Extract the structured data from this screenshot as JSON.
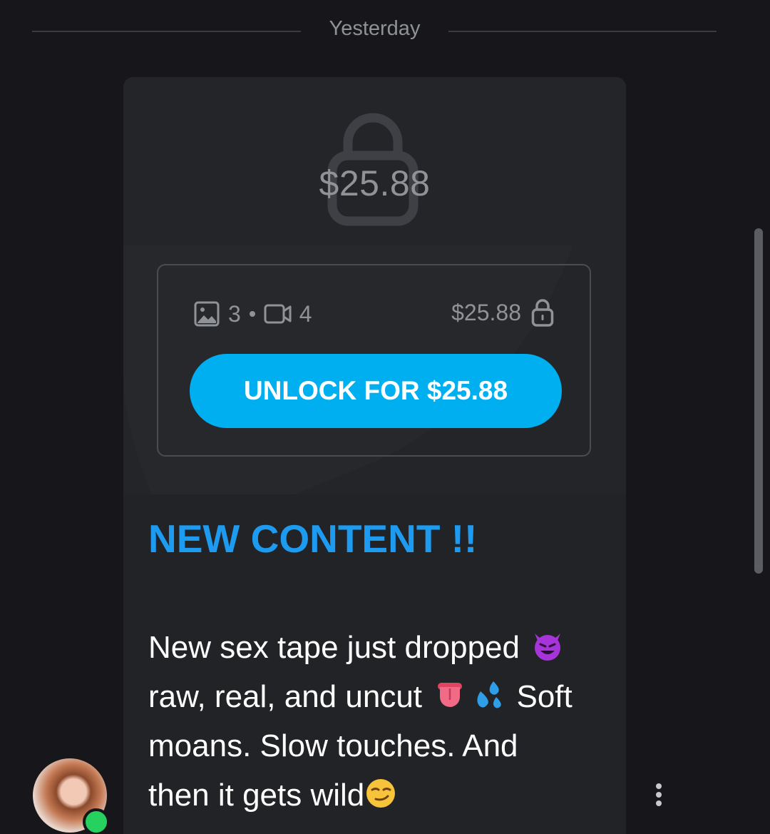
{
  "date_divider": {
    "label": "Yesterday"
  },
  "locked_post": {
    "overlay_price": "$25.88",
    "photo_count": "3",
    "video_count": "4",
    "box_price": "$25.88",
    "unlock_label": "UNLOCK FOR $25.88"
  },
  "message": {
    "headline": "NEW CONTENT !!",
    "line1": "New sex tape just dropped",
    "line2": "raw, real, and uncut",
    "line2_tail": "Soft",
    "line3": "moans. Slow touches. And",
    "line4": "then it gets wild",
    "emojis": [
      "smiling-devil-emoji",
      "tongue-emoji",
      "sweat-droplets-emoji",
      "smirking-face-emoji"
    ]
  },
  "sender": {
    "status": "online"
  },
  "colors": {
    "accent_button": "#00aff0",
    "headline": "#1d9bf0",
    "online": "#27d15f",
    "background": "#17171b",
    "card": "#222327"
  }
}
